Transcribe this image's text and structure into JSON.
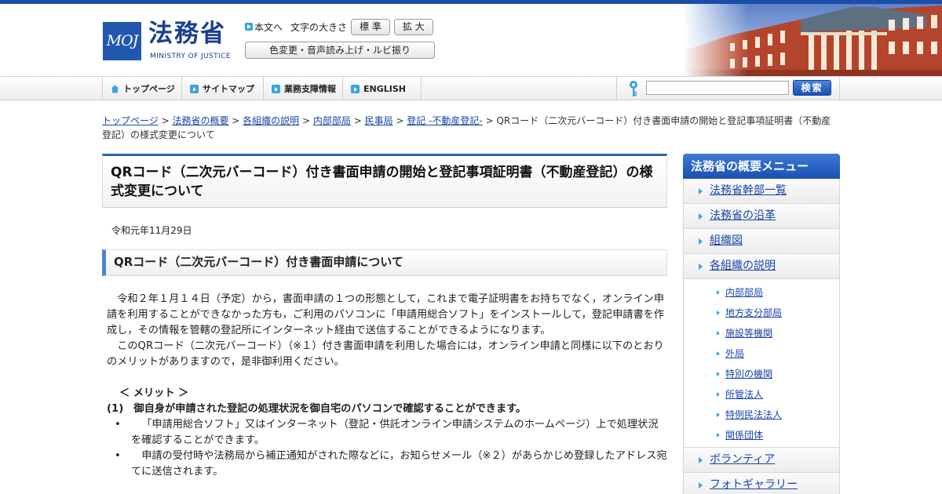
{
  "header": {
    "logo_mark": "MOJ",
    "logo_kanji": "法務省",
    "logo_en": "MINISTRY OF JUSTICE",
    "skip_link": "本文へ",
    "font_size_label": "文字の大きさ",
    "size_standard": "標 準",
    "size_large": "拡 大",
    "accessibility_button": "色変更・音声読み上げ・ルビ振り"
  },
  "nav": {
    "items": [
      "トップページ",
      "サイトマップ",
      "業務支障情報",
      "ENGLISH"
    ],
    "search_placeholder": "",
    "search_button": "検索"
  },
  "breadcrumb": {
    "links": [
      "トップページ",
      "法務省の概要",
      "各組織の説明",
      "内部部局",
      "民事局",
      "登記 -不動産登記-"
    ],
    "current": "QRコード（二次元バーコード）付き書面申請の開始と登記事項証明書（不動産登記）の様式変更について"
  },
  "main": {
    "title": "QRコード（二次元バーコード）付き書面申請の開始と登記事項証明書（不動産登記）の様式変更について",
    "date": "令和元年11月29日",
    "section_heading": "QRコード（二次元バーコード）付き書面申請について",
    "para1": "令和２年１月１４日（予定）から，書面申請の１つの形態として，これまで電子証明書をお持ちでなく，オンライン申請を利用することができなかった方も，ご利用のパソコンに「申請用総合ソフト」をインストールして，登記申請書を作成し，その情報を管轄の登記所にインターネット経由で送信することができるようになります。",
    "para2": "このQRコード（二次元バーコード）（※１）付き書面申請を利用した場合には，オンライン申請と同様に以下のとおりのメリットがありますので，是非御利用ください。",
    "merit_title": "＜ メリット ＞",
    "merit_1": "(1)　御自身が申請された登記の処理状況を御自宅のパソコンで確認することができます。",
    "bullets": [
      "「申請用総合ソフト」又はインターネット（登記・供託オンライン申請システムのホームページ）上で処理状況を確認することができます。",
      "申請の受付時や法務局から補正通知がされた際などに，お知らせメール（※２）があらかじめ登録したアドレス宛てに送信されます。"
    ]
  },
  "sidebar": {
    "heading": "法務省の概要メニュー",
    "items_top": [
      "法務省幹部一覧",
      "法務省の沿革",
      "組織図",
      "各組織の説明"
    ],
    "sub_items": [
      "内部部局",
      "地方支分部局",
      "施設等機関",
      "外局",
      "特別の機関",
      "所管法人",
      "特例民法法人",
      "関係団体"
    ],
    "items_bottom": [
      "ボランティア",
      "フォトギャラリー"
    ]
  },
  "colors": {
    "brand_blue": "#1b3f8f",
    "accent_blue": "#2e5fb8",
    "link": "#1a44a8",
    "icon_cyan": "#3aa3d9"
  }
}
